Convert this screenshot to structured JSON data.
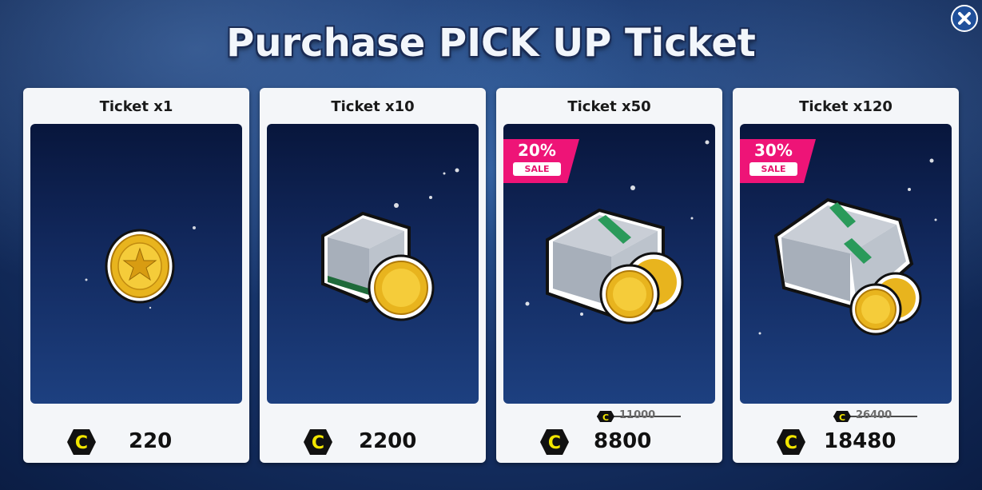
{
  "title": "Purchase PICK UP Ticket",
  "close_icon": "close-x-icon",
  "currency_icon": "c-coin-icon",
  "colors": {
    "sale_badge": "#ee1477",
    "currency_icon": "#f2e600",
    "card_bg": "#f4f6f9"
  },
  "products": [
    {
      "label": "Ticket x1",
      "price": "220",
      "old_price": "",
      "discount": "",
      "sale_text": ""
    },
    {
      "label": "Ticket x10",
      "price": "2200",
      "old_price": "",
      "discount": "",
      "sale_text": ""
    },
    {
      "label": "Ticket x50",
      "price": "8800",
      "old_price": "11000",
      "discount": "20%",
      "sale_text": "SALE"
    },
    {
      "label": "Ticket x120",
      "price": "18480",
      "old_price": "26400",
      "discount": "30%",
      "sale_text": "SALE"
    }
  ]
}
